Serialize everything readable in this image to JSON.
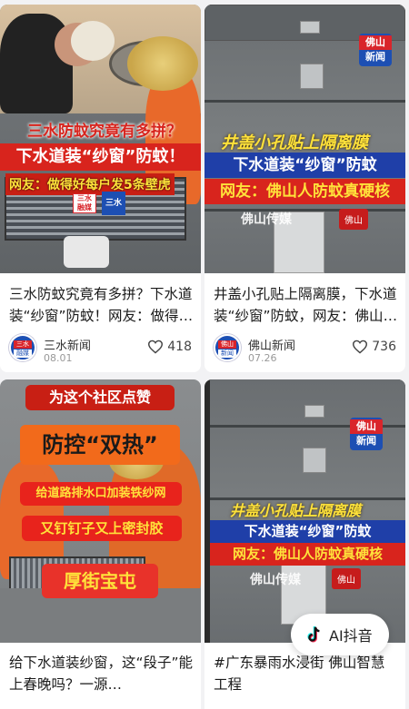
{
  "feed": {
    "cards": [
      {
        "title": "三水防蚊究竟有多拼？下水道装“纱窗”防蚊！网友：做得好每户发5条壁虎",
        "author": "三水新闻",
        "date": "08.01",
        "likes": "418",
        "avatar_top": "三水",
        "avatar_bottom": "融媒",
        "overlay": {
          "question": "三水防蚊究竟有多拼？",
          "headline": "下水道装“纱窗”防蚊！",
          "netizen": "网友：做得好每户发5条壁虎",
          "badge1": "三水",
          "badge1b": "融媒",
          "badge2": "三水"
        }
      },
      {
        "title": "井盖小孔贴上隔离膜，下水道装“纱窗”防蚊，网友：佛山人防蚊真硬核",
        "author": "佛山新闻",
        "date": "07.26",
        "likes": "736",
        "avatar_top": "佛山",
        "avatar_bottom": "新闻",
        "overlay": {
          "logo_top": "佛山",
          "logo_bottom": "新闻",
          "line1": "井盖小孔贴上隔离膜",
          "line2": "下水道装“纱窗”防蚊",
          "line3": "网友：佛山人防蚊真硬核",
          "watermark": "佛山传媒",
          "badge": "佛山"
        }
      },
      {
        "title": "给下水道装纱窗，这“段子”能上春晚吗？一源…",
        "overlay": {
          "line1": "为这个社区点赞",
          "line2": "防控“双热”",
          "line3": "给道路排水口加装铁纱网",
          "line4": "又钉钉子又上密封胶",
          "line5": "厚街宝屯"
        }
      },
      {
        "title": "#广东暴雨水浸街 佛山智慧工程",
        "overlay": {
          "logo_top": "佛山",
          "logo_bottom": "新闻",
          "line1": "井盖小孔贴上隔离膜",
          "line2": "下水道装“纱窗”防蚊",
          "line3": "网友：佛山人防蚊真硬核",
          "watermark": "佛山传媒",
          "badge": "佛山"
        }
      }
    ]
  },
  "ai_button": {
    "label": "AI抖音",
    "icon": "tiktok-icon"
  },
  "colors": {
    "brand_red": "#d8241d",
    "brand_blue": "#1f3fa8",
    "background": "#f2f2f4"
  }
}
